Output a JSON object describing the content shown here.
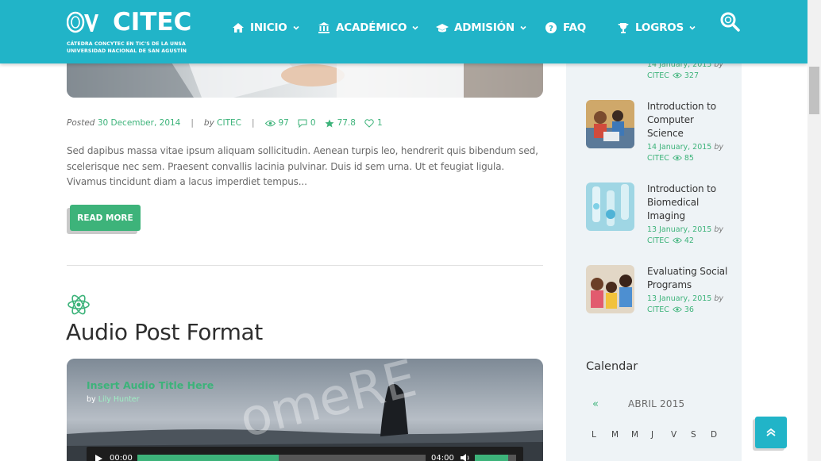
{
  "header": {
    "logo_word": "CITEC",
    "logo_sub1": "CÁTEDRA CONCYTEC EN TIC'S DE LA UNSA",
    "logo_sub2": "UNIVERSIDAD NACIONAL DE SAN AGUSTÍN",
    "nav": [
      {
        "label": "INICIO",
        "icon": "home-icon",
        "has_dropdown": true
      },
      {
        "label": "ACADÉMICO",
        "icon": "bank-icon",
        "has_dropdown": true
      },
      {
        "label": "ADMISIÓN",
        "icon": "graduation-cap-icon",
        "has_dropdown": true
      },
      {
        "label": "FAQ",
        "icon": "question-circle-icon",
        "has_dropdown": false
      },
      {
        "label": "LOGROS",
        "icon": "trophy-icon",
        "has_dropdown": true
      }
    ],
    "bg_color": "#21b4c8"
  },
  "post1": {
    "posted_label": "Posted",
    "date": "30 December, 2014",
    "by_label": "by",
    "author": "CITEC",
    "views": "97",
    "comments": "0",
    "rating": "77.8",
    "likes": "1",
    "excerpt": "Sed dapibus massa vitae ipsum aliquam sollicitudin. Aenean turpis leo, hendrerit quis bibendum sed, scelerisque nec sem. Praesent convallis lacinia pulvinar. Duis id sem urna. Ut et feugiat ligula. Vivamus tincidunt diam a lacus imperdiet tempus...",
    "read_more": "READ MORE"
  },
  "post2": {
    "title": "Audio Post Format",
    "audio_title": "Insert Audio Title Here",
    "audio_by_label": "by",
    "audio_author": "Lily Hunter",
    "time_current": "00:00",
    "time_total": "04:00",
    "progress": 0.49,
    "volume": 0.8
  },
  "sidebar": {
    "top_item": {
      "date": "14 January, 2015",
      "by_label": "by",
      "author": "CITEC",
      "views": "327"
    },
    "recent_posts": [
      {
        "title": "Introduction to Computer Science",
        "date": "14 January, 2015",
        "by_label": "by",
        "author": "CITEC",
        "views": "85"
      },
      {
        "title": "Introduction to Biomedical Imaging",
        "date": "13 January, 2015",
        "by_label": "by",
        "author": "CITEC",
        "views": "42"
      },
      {
        "title": "Evaluating Social Programs",
        "date": "13 January, 2015",
        "by_label": "by",
        "author": "CITEC",
        "views": "36"
      }
    ],
    "calendar": {
      "title": "Calendar",
      "prev": "«",
      "month": "ABRIL 2015",
      "days": [
        "L",
        "M",
        "M",
        "J",
        "V",
        "S",
        "D"
      ]
    }
  },
  "colors": {
    "accent_green": "#3db37a",
    "brand_teal": "#21b4c8"
  }
}
